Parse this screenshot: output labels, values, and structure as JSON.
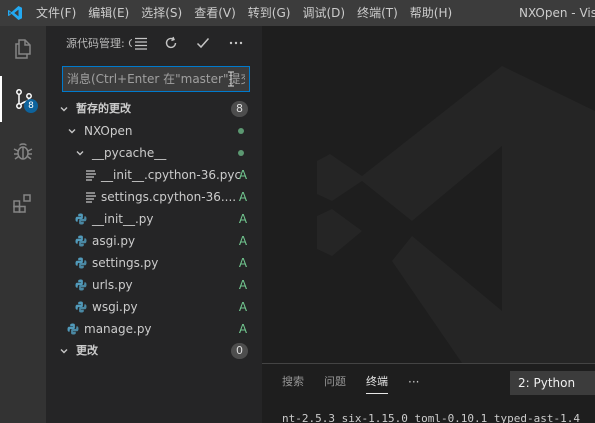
{
  "menu": [
    "文件(F)",
    "编辑(E)",
    "选择(S)",
    "查看(V)",
    "转到(G)",
    "调试(D)",
    "终端(T)",
    "帮助(H)"
  ],
  "window_title": "NXOpen - Visual Studio Code",
  "activity": {
    "scm_badge": "8"
  },
  "sidebar": {
    "title": "源代码管理: GIT",
    "commit_placeholder": "消息(Ctrl+Enter 在\"master\"提交)",
    "staged_group": {
      "label": "暂存的更改",
      "count": "8"
    },
    "changes_group": {
      "label": "更改",
      "count": "0"
    },
    "items": [
      {
        "label": "NXOpen",
        "kind": "folder"
      },
      {
        "label": "__pycache__",
        "kind": "folder"
      },
      {
        "label": "__init__.cpython-36.pyc",
        "status": "A"
      },
      {
        "label": "settings.cpython-36....",
        "status": "A"
      },
      {
        "label": "__init__.py",
        "status": "A"
      },
      {
        "label": "asgi.py",
        "status": "A"
      },
      {
        "label": "settings.py",
        "status": "A"
      },
      {
        "label": "urls.py",
        "status": "A"
      },
      {
        "label": "wsgi.py",
        "status": "A"
      },
      {
        "label": "manage.py",
        "status": "A"
      }
    ]
  },
  "panel": {
    "tabs": [
      "搜索",
      "问题",
      "终端"
    ],
    "more": "···",
    "terminal_select": "2: Python",
    "terminal_line": "nt-2.5.3 six-1.15.0 toml-0.10.1 typed-ast-1.4"
  },
  "colors": {
    "accent": "#007acc",
    "added": "#73c991",
    "python": "#519aba"
  }
}
